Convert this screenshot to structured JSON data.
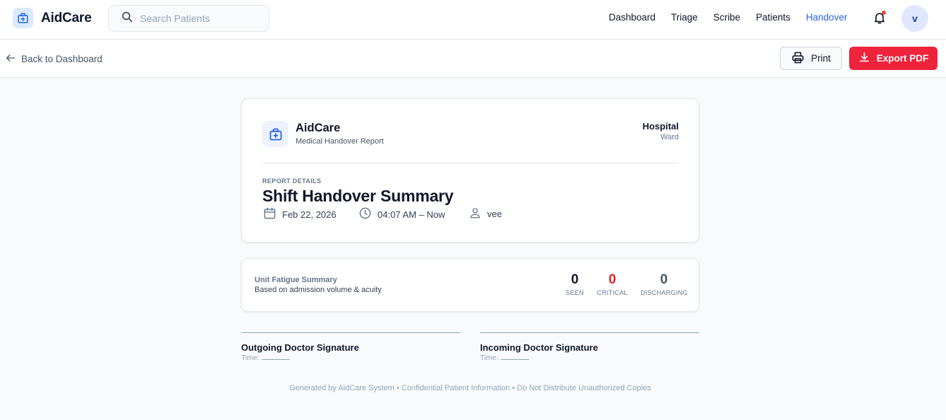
{
  "app": {
    "name": "AidCare"
  },
  "search": {
    "placeholder": "Search Patients"
  },
  "nav": {
    "items": [
      {
        "label": "Dashboard"
      },
      {
        "label": "Triage"
      },
      {
        "label": "Scribe"
      },
      {
        "label": "Patients"
      },
      {
        "label": "Handover",
        "active": true
      }
    ]
  },
  "user": {
    "initial": "v"
  },
  "subbar": {
    "back_label": "Back to Dashboard",
    "print_label": "Print",
    "export_label": "Export PDF"
  },
  "report": {
    "brand": "AidCare",
    "subtitle": "Medical Handover Report",
    "hospital": "Hospital",
    "ward": "Ward",
    "details_label": "REPORT DETAILS",
    "title": "Shift Handover Summary",
    "date": "Feb 22, 2026",
    "time": "04:07 AM – Now",
    "author": "vee"
  },
  "fatigue": {
    "title": "Unit Fatigue Summary",
    "subtitle": "Based on admission volume & acuity",
    "stats": [
      {
        "value": "0",
        "label": "SEEN"
      },
      {
        "value": "0",
        "label": "CRITICAL"
      },
      {
        "value": "0",
        "label": "DISCHARGING"
      }
    ]
  },
  "signatures": {
    "outgoing": {
      "title": "Outgoing Doctor Signature",
      "time_label": "Time:"
    },
    "incoming": {
      "title": "Incoming Doctor Signature",
      "time_label": "Time:"
    }
  },
  "footer": {
    "text": "Generated by AidCare System • Confidential Patient Information • Do Not Distribute Unauthorized Copies"
  },
  "colors": {
    "accent": "#2563eb",
    "danger": "#ef233c",
    "critical": "#dc2626"
  },
  "icons": [
    "medical-kit-icon",
    "search-icon",
    "bell-icon",
    "arrow-left-icon",
    "printer-icon",
    "download-icon",
    "calendar-icon",
    "clock-icon",
    "user-icon"
  ]
}
